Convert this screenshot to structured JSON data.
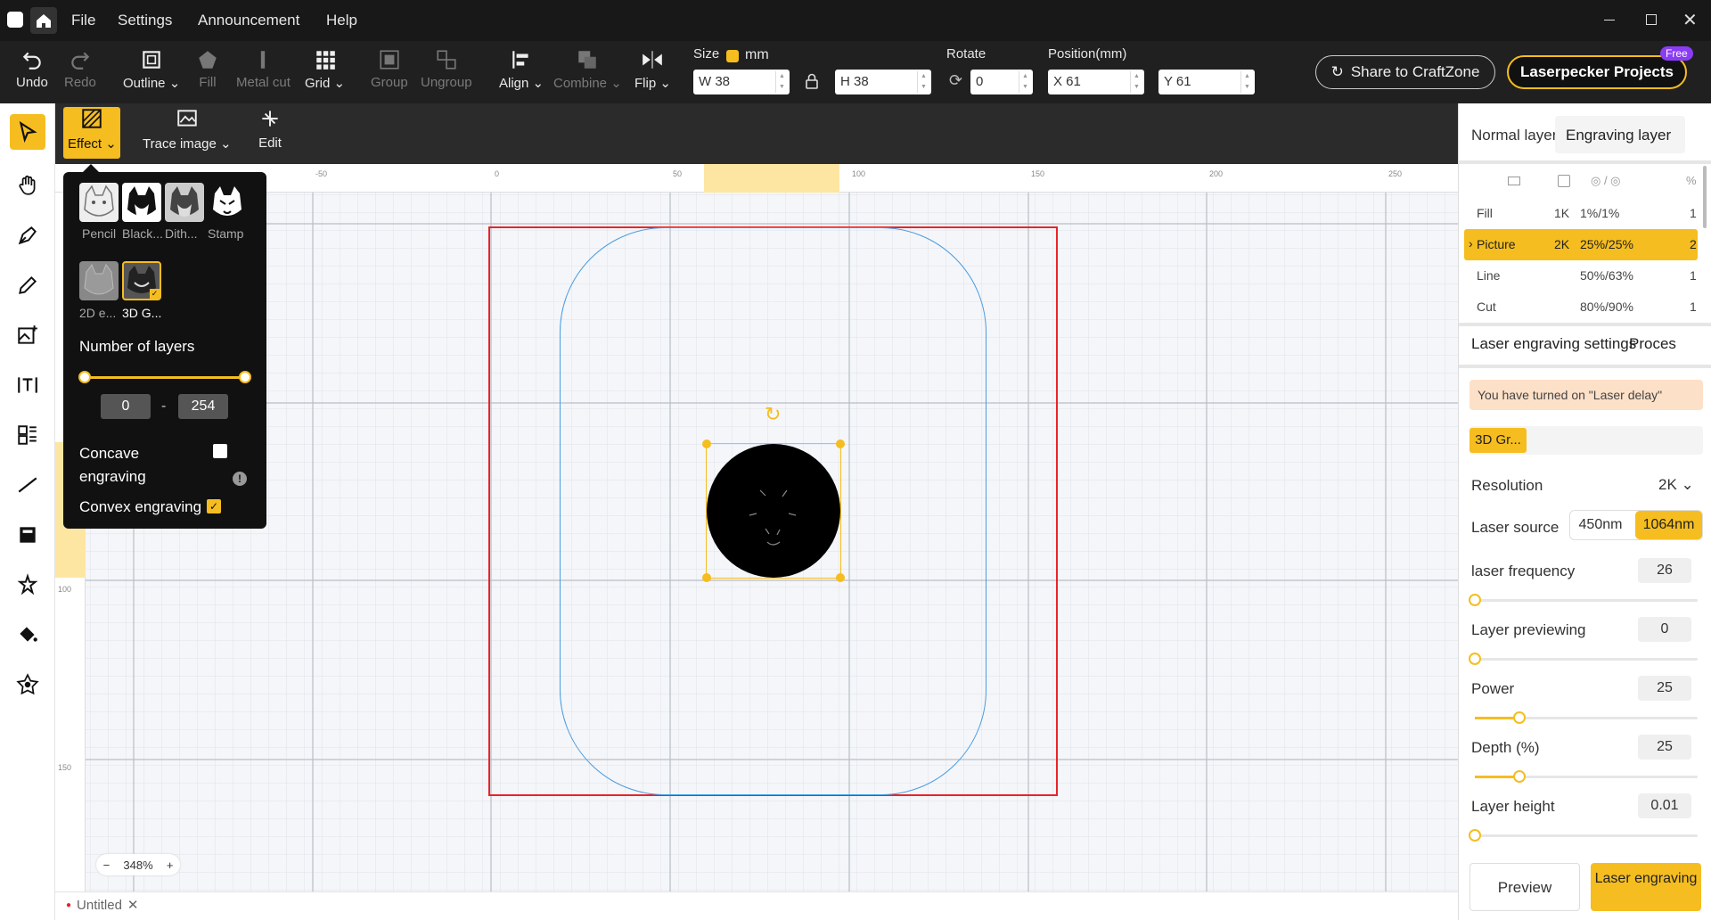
{
  "titlebar": {
    "menu": [
      "File",
      "Settings",
      "Announcement",
      "Help"
    ]
  },
  "toolbar": {
    "undo": "Undo",
    "redo": "Redo",
    "outline": "Outline",
    "fill": "Fill",
    "metal_cut": "Metal cut",
    "grid": "Grid",
    "group": "Group",
    "ungroup": "Ungroup",
    "align": "Align",
    "combine": "Combine",
    "flip": "Flip",
    "size_label": "Size",
    "unit": "mm",
    "width": "W 38",
    "height": "H 38",
    "rotate_label": "Rotate",
    "rotate": "0",
    "position_label": "Position(mm)",
    "pos_x": "X 61",
    "pos_y": "Y 61",
    "share": "Share to CraftZone",
    "projects": "Laserpecker Projects",
    "free_badge": "Free"
  },
  "subbar": {
    "effect": "Effect",
    "trace_image": "Trace image",
    "edit": "Edit"
  },
  "effect_popup": {
    "styles": [
      "Pencil",
      "Black...",
      "Dith...",
      "Stamp",
      "2D e...",
      "3D G..."
    ],
    "layers_title": "Number of layers",
    "range_min": "0",
    "range_sep": "-",
    "range_max": "254",
    "concave": "Concave engraving",
    "convex": "Convex engraving"
  },
  "ruler": {
    "top_labels": [
      "-50",
      "0",
      "50",
      "100",
      "150",
      "200",
      "250"
    ],
    "left_labels": [
      "100",
      "150"
    ]
  },
  "zoom": "348%",
  "file_tab": {
    "name": "Untitled"
  },
  "right_panel": {
    "tabs": [
      "Normal layer",
      "Engraving layer"
    ],
    "layers": [
      {
        "name": "Fill",
        "res": "1K",
        "power": "1%/1%",
        "count": "1"
      },
      {
        "name": "Picture",
        "res": "2K",
        "power": "25%/25%",
        "count": "2"
      },
      {
        "name": "Line",
        "res": "",
        "power": "50%/63%",
        "count": "1"
      },
      {
        "name": "Cut",
        "res": "",
        "power": "80%/90%",
        "count": "1"
      }
    ],
    "settings_tabs": [
      "Laser engraving settings",
      "Proces"
    ],
    "warning": "You have turned on \"Laser delay\"",
    "mode_chip": "3D Gr...",
    "resolution_label": "Resolution",
    "resolution": "2K",
    "laser_source_label": "Laser source",
    "source_a": "450nm",
    "source_b": "1064nm",
    "freq_label": "laser frequency",
    "freq": "26",
    "preview_layer_label": "Layer previewing",
    "preview_layer": "0",
    "power_label": "Power",
    "power": "25",
    "depth_label": "Depth (%)",
    "depth": "25",
    "layer_height_label": "Layer height",
    "layer_height": "0.01",
    "preview_btn": "Preview",
    "engrave_btn": "Laser engraving"
  },
  "colors": {
    "accent": "#f5bd1f",
    "selection_red": "#e8242a",
    "outline_blue": "#4a9be0"
  }
}
